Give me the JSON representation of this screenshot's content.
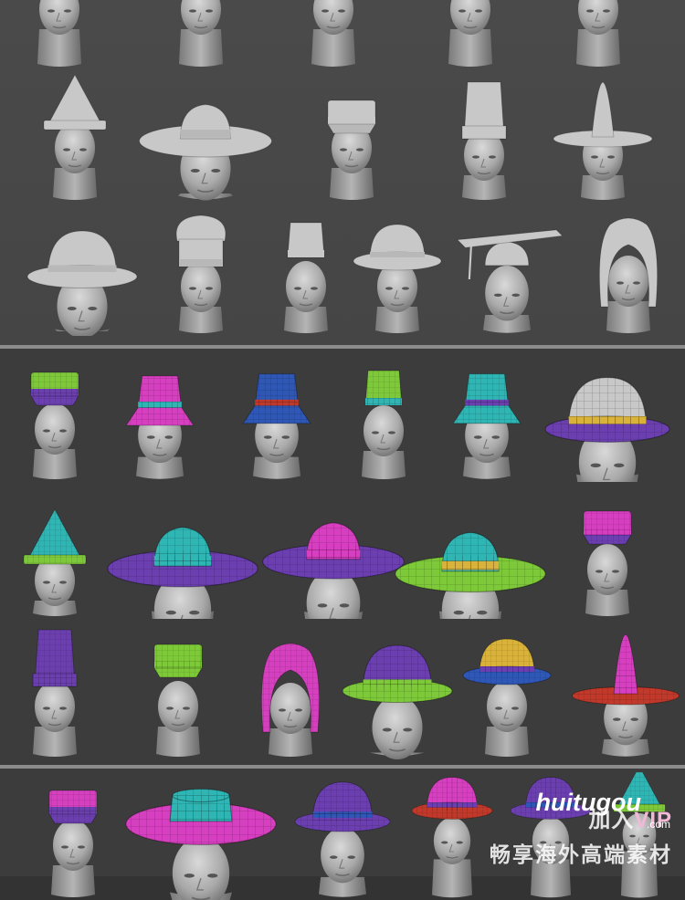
{
  "gallery": {
    "panels": [
      {
        "name": "untextured-hats",
        "rows": 3,
        "style": "gray clay render"
      },
      {
        "name": "uv-grid-hats",
        "rows": 3,
        "style": "colored polygroup wireframe"
      },
      {
        "name": "uv-grid-hats-partial",
        "rows": 1,
        "style": "colored polygroup wireframe"
      }
    ],
    "colors": {
      "clay": "#c8c8c8",
      "magenta": "#d63fbf",
      "teal": "#2fb6b4",
      "green": "#7ec93a",
      "purple": "#6b3fb0",
      "gold": "#d8b23a",
      "red": "#c0392b",
      "blue": "#2f57b5"
    }
  },
  "watermark": {
    "join_text": "加入",
    "vip_text": "VIP",
    "logo_text": "huitugou",
    "logo_suffix": ".com",
    "slogan": "畅享海外高端素材"
  }
}
